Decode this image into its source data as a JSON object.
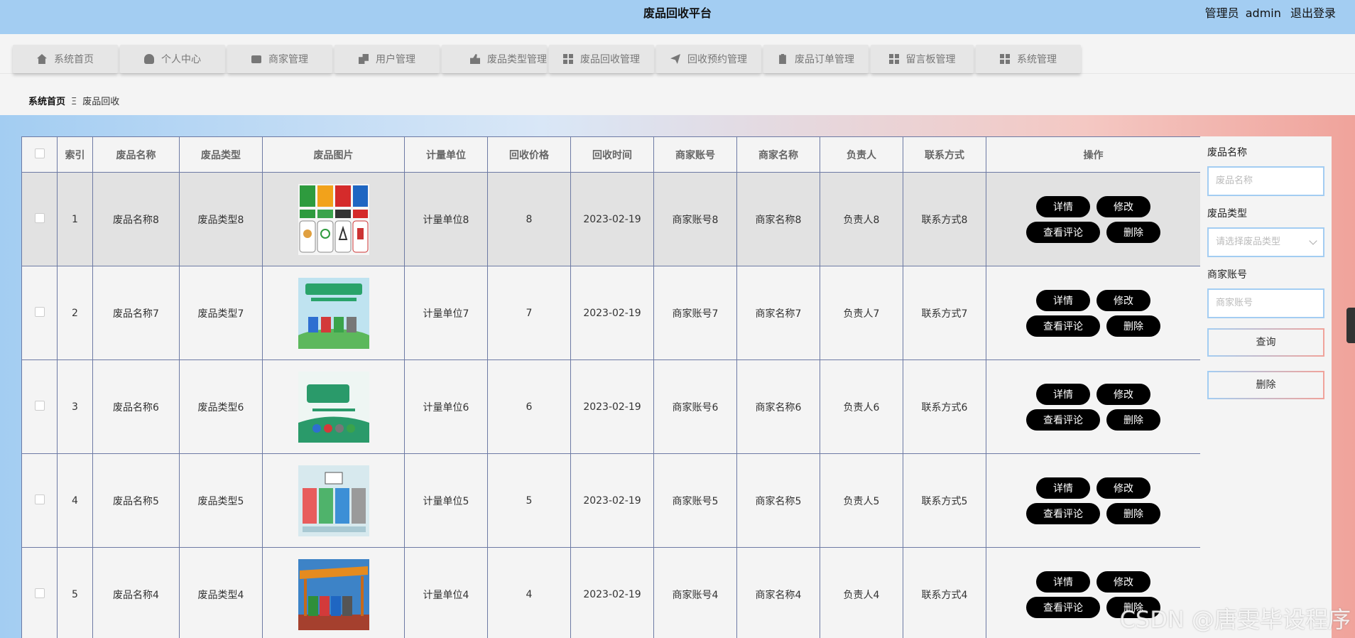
{
  "header": {
    "title": "废品回收平台",
    "user_role": "管理员",
    "username": "admin",
    "logout": "退出登录"
  },
  "nav": [
    {
      "label": "系统首页",
      "icon": "home-icon"
    },
    {
      "label": "个人中心",
      "icon": "person-icon"
    },
    {
      "label": "商家管理",
      "icon": "monitor-icon"
    },
    {
      "label": "用户管理",
      "icon": "users-icon"
    },
    {
      "label": "废品类型管理",
      "icon": "thumbs-up-icon"
    },
    {
      "label": "废品回收管理",
      "icon": "grid-icon"
    },
    {
      "label": "回收预约管理",
      "icon": "paper-plane-icon"
    },
    {
      "label": "废品订单管理",
      "icon": "clipboard-icon"
    },
    {
      "label": "留言板管理",
      "icon": "grid-icon"
    },
    {
      "label": "系统管理",
      "icon": "grid-icon"
    }
  ],
  "breadcrumb": {
    "home": "系统首页",
    "separator": "Ξ",
    "current": "废品回收"
  },
  "table": {
    "headers": [
      "",
      "索引",
      "废品名称",
      "废品类型",
      "废品图片",
      "计量单位",
      "回收价格",
      "回收时间",
      "商家账号",
      "商家名称",
      "负责人",
      "联系方式",
      "操作"
    ],
    "rows": [
      {
        "index": "1",
        "name": "废品名称8",
        "type": "废品类型8",
        "unit": "计量单位8",
        "price": "8",
        "time": "2023-02-19",
        "account": "商家账号8",
        "merchant": "商家名称8",
        "owner": "负责人8",
        "contact": "联系方式8"
      },
      {
        "index": "2",
        "name": "废品名称7",
        "type": "废品类型7",
        "unit": "计量单位7",
        "price": "7",
        "time": "2023-02-19",
        "account": "商家账号7",
        "merchant": "商家名称7",
        "owner": "负责人7",
        "contact": "联系方式7"
      },
      {
        "index": "3",
        "name": "废品名称6",
        "type": "废品类型6",
        "unit": "计量单位6",
        "price": "6",
        "time": "2023-02-19",
        "account": "商家账号6",
        "merchant": "商家名称6",
        "owner": "负责人6",
        "contact": "联系方式6"
      },
      {
        "index": "4",
        "name": "废品名称5",
        "type": "废品类型5",
        "unit": "计量单位5",
        "price": "5",
        "time": "2023-02-19",
        "account": "商家账号5",
        "merchant": "商家名称5",
        "owner": "负责人5",
        "contact": "联系方式5"
      },
      {
        "index": "5",
        "name": "废品名称4",
        "type": "废品类型4",
        "unit": "计量单位4",
        "price": "4",
        "time": "2023-02-19",
        "account": "商家账号4",
        "merchant": "商家名称4",
        "owner": "负责人4",
        "contact": "联系方式4"
      }
    ],
    "actions": {
      "detail": "详情",
      "edit": "修改",
      "comments": "查看评论",
      "delete": "删除"
    }
  },
  "search": {
    "name_label": "废品名称",
    "name_placeholder": "废品名称",
    "type_label": "废品类型",
    "type_placeholder": "请选择废品类型",
    "account_label": "商家账号",
    "account_placeholder": "商家账号",
    "query_button": "查询",
    "delete_button": "删除"
  },
  "watermark": "CSDN @唐雯毕设程序",
  "colors": {
    "topbar": "#a3cdf2",
    "gradient_end": "#f0a39b",
    "button": "#000000",
    "table_border": "#6d7aa4",
    "selected_row": "#e2e2e2"
  }
}
